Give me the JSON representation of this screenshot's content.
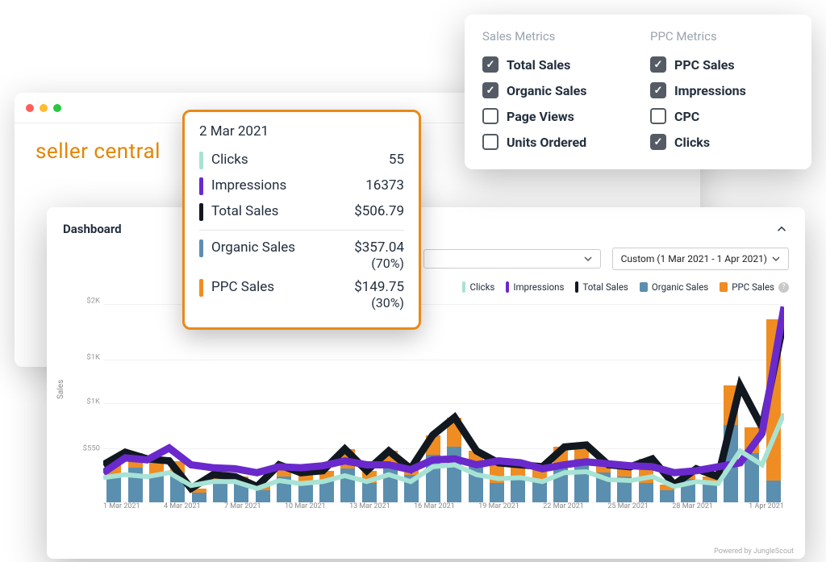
{
  "brand": "seller central",
  "dashboard_title": "Dashboard",
  "date_range_label": "Custom (1 Mar 2021 - 1 Apr 2021)",
  "credit": "Powered by JungleScout",
  "legend": {
    "clicks": "Clicks",
    "impressions": "Impressions",
    "total": "Total Sales",
    "organic": "Organic Sales",
    "ppc": "PPC Sales"
  },
  "tooltip": {
    "date": "2 Mar 2021",
    "rows": [
      {
        "label": "Clicks",
        "value": "55",
        "color": "#a7e3d5"
      },
      {
        "label": "Impressions",
        "value": "16373",
        "color": "#6a29cc"
      },
      {
        "label": "Total Sales",
        "value": "$506.79",
        "color": "#111820"
      }
    ],
    "split": [
      {
        "label": "Organic Sales",
        "value": "$357.04",
        "pct": "(70%)",
        "color": "#5b8fb0"
      },
      {
        "label": "PPC Sales",
        "value": "$149.75",
        "pct": "(30%)",
        "color": "#ef8d22"
      }
    ]
  },
  "popover": {
    "headers": {
      "sales": "Sales Metrics",
      "ppc": "PPC Metrics"
    },
    "sales": [
      {
        "label": "Total Sales",
        "on": true
      },
      {
        "label": "Organic Sales",
        "on": true
      },
      {
        "label": "Page Views",
        "on": false
      },
      {
        "label": "Units Ordered",
        "on": false
      }
    ],
    "ppc": [
      {
        "label": "PPC Sales",
        "on": true
      },
      {
        "label": "Impressions",
        "on": true
      },
      {
        "label": "CPC",
        "on": false
      },
      {
        "label": "Clicks",
        "on": true
      }
    ]
  },
  "axis": {
    "ylabel": "Sales",
    "yticks": [
      "$2K",
      "$1K",
      "$1K",
      "$550"
    ]
  },
  "chart_data": {
    "type": "bar",
    "title": "Sales dashboard",
    "ylabel": "Sales",
    "ylim": [
      0,
      2000
    ],
    "categories": [
      "1 Mar 2021",
      "2 Mar 2021",
      "3 Mar 2021",
      "4 Mar 2021",
      "5 Mar 2021",
      "6 Mar 2021",
      "7 Mar 2021",
      "8 Mar 2021",
      "9 Mar 2021",
      "10 Mar 2021",
      "11 Mar 2021",
      "12 Mar 2021",
      "13 Mar 2021",
      "14 Mar 2021",
      "15 Mar 2021",
      "16 Mar 2021",
      "17 Mar 2021",
      "18 Mar 2021",
      "19 Mar 2021",
      "20 Mar 2021",
      "21 Mar 2021",
      "22 Mar 2021",
      "23 Mar 2021",
      "24 Mar 2021",
      "25 Mar 2021",
      "26 Mar 2021",
      "27 Mar 2021",
      "28 Mar 2021",
      "29 Mar 2021",
      "30 Mar 2021",
      "31 Mar 2021",
      "1 Apr 2021"
    ],
    "x_tick_labels": [
      "1 Mar 2021",
      "4 Mar 2021",
      "7 Mar 2021",
      "10 Mar 2021",
      "13 Mar 2021",
      "16 Mar 2021",
      "19 Mar 2021",
      "22 Mar 2021",
      "25 Mar 2021",
      "28 Mar 2021",
      "1 Apr 2021"
    ],
    "series": [
      {
        "name": "Organic Sales",
        "color": "#5b8fb0",
        "values": [
          260,
          350,
          280,
          300,
          100,
          200,
          200,
          120,
          260,
          200,
          220,
          340,
          200,
          360,
          280,
          480,
          560,
          360,
          200,
          260,
          240,
          380,
          440,
          300,
          260,
          200,
          120,
          240,
          200,
          780,
          500,
          220
        ]
      },
      {
        "name": "PPC Sales",
        "color": "#ef8d22",
        "values": [
          120,
          150,
          160,
          120,
          40,
          80,
          60,
          40,
          120,
          100,
          100,
          200,
          120,
          160,
          60,
          200,
          300,
          160,
          200,
          120,
          120,
          180,
          140,
          80,
          100,
          240,
          60,
          100,
          60,
          400,
          260,
          1630
        ]
      }
    ],
    "lines": [
      {
        "name": "Total Sales",
        "color": "#111820",
        "values": [
          380,
          507,
          440,
          420,
          140,
          280,
          260,
          160,
          380,
          300,
          320,
          540,
          320,
          520,
          340,
          680,
          860,
          520,
          400,
          380,
          360,
          560,
          580,
          380,
          360,
          440,
          180,
          340,
          260,
          1180,
          760,
          1850
        ]
      },
      {
        "name": "Impressions",
        "color": "#6a29cc",
        "values": [
          300,
          450,
          430,
          550,
          380,
          350,
          340,
          300,
          360,
          350,
          370,
          420,
          380,
          380,
          330,
          430,
          440,
          380,
          420,
          400,
          340,
          380,
          410,
          390,
          370,
          360,
          300,
          320,
          360,
          400,
          700,
          1980
        ]
      },
      {
        "name": "Clicks",
        "color": "#a7e3d5",
        "values": [
          250,
          280,
          260,
          300,
          170,
          210,
          210,
          140,
          220,
          190,
          210,
          270,
          210,
          280,
          210,
          360,
          380,
          280,
          240,
          250,
          210,
          300,
          310,
          230,
          220,
          260,
          160,
          210,
          190,
          520,
          380,
          900
        ]
      }
    ]
  }
}
